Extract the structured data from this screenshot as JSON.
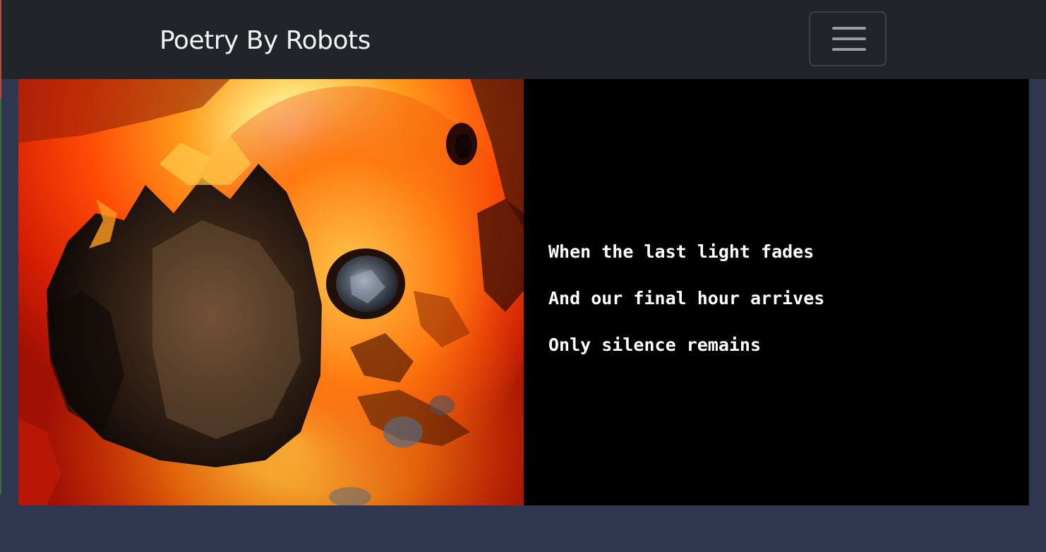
{
  "navbar": {
    "brand": "Poetry By Robots",
    "toggler_icon": "hamburger-menu-icon"
  },
  "post": {
    "artwork": {
      "subject": "burning-skull-artwork",
      "palette": [
        "#c41a06",
        "#ff5a00",
        "#ffd23c",
        "#fff6c8",
        "#1a0a06"
      ]
    },
    "poem": {
      "lines": [
        "When the last light fades",
        "And our final hour arrives",
        "Only silence remains"
      ]
    }
  },
  "colors": {
    "navbar_bg": "#212428",
    "page_bg": "#2f3650",
    "poem_bg": "#000000",
    "poem_text": "#ffffff"
  }
}
